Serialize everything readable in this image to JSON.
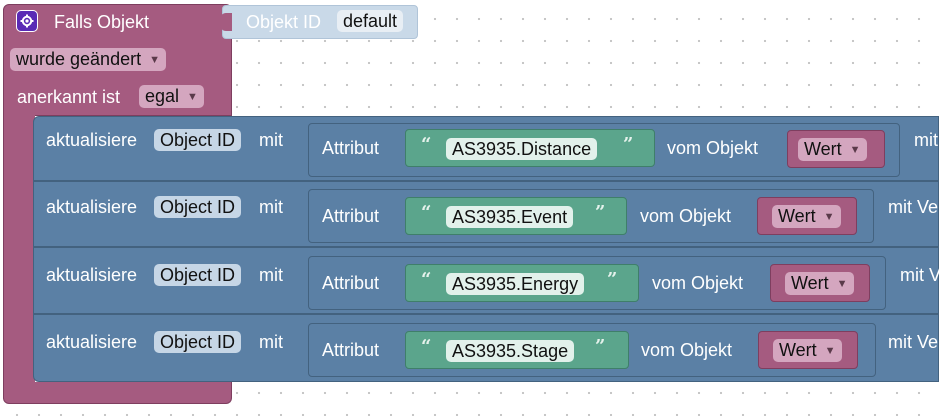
{
  "trigger": {
    "gear_icon": "gear-icon",
    "title": "Falls Objekt",
    "object_id_label": "Objekt ID",
    "object_id_value": "default",
    "changed_value": "wurde geändert",
    "ack_label": "anerkannt ist",
    "ack_value": "egal"
  },
  "rows": [
    {
      "update_label": "aktualisiere",
      "object_id": "Object ID",
      "with_label": "mit",
      "attribute_label": "Attribut",
      "attribute_value": "AS3935.Distance",
      "from_object_label": "vom Objekt",
      "value_dropdown": "Wert",
      "trailing_label": "mit"
    },
    {
      "update_label": "aktualisiere",
      "object_id": "Object ID",
      "with_label": "mit",
      "attribute_label": "Attribut",
      "attribute_value": "AS3935.Event",
      "from_object_label": "vom Objekt",
      "value_dropdown": "Wert",
      "trailing_label": "mit Ve"
    },
    {
      "update_label": "aktualisiere",
      "object_id": "Object ID",
      "with_label": "mit",
      "attribute_label": "Attribut",
      "attribute_value": "AS3935.Energy",
      "from_object_label": "vom Objekt",
      "value_dropdown": "Wert",
      "trailing_label": "mit V"
    },
    {
      "update_label": "aktualisiere",
      "object_id": "Object ID",
      "with_label": "mit",
      "attribute_label": "Attribut",
      "attribute_value": "AS3935.Stage",
      "from_object_label": "vom Objekt",
      "value_dropdown": "Wert",
      "trailing_label": "mit Ve"
    }
  ],
  "colors": {
    "trigger_block": "#a55b80",
    "action_block": "#5b80a5",
    "text_block": "#5ba58c",
    "dropdown_pink": "#d4a6bf",
    "dropdown_blue": "#c6d6e6",
    "text_field": "#bfe0d4"
  }
}
